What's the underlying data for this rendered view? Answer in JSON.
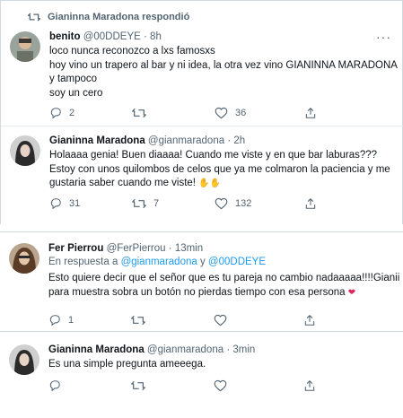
{
  "replied_banner": {
    "text": "Gianinna Maradona respondió"
  },
  "tweets": [
    {
      "name": "benito",
      "handle": "@00DDEYE",
      "time": "8h",
      "lines": [
        "loco nunca reconozco a lxs famosxs",
        "hoy vino un trapero al bar y ni idea, la otra vez vino GIANINNA MARADONA",
        "y tampoco",
        "soy un cero"
      ],
      "stats": {
        "replies": "2",
        "retweets": "",
        "likes": "36"
      }
    },
    {
      "name": "Gianinna Maradona",
      "handle": "@gianmaradona",
      "time": "2h",
      "lines": [
        "Holaaaa genia! Buen diaaaa! Cuando me viste y en que bar laburas???",
        "Estoy con unos quilombos de celos que ya me colmaron la paciencia y me",
        "gustaria saber cuando me viste!"
      ],
      "stats": {
        "replies": "31",
        "retweets": "7",
        "likes": "132"
      }
    },
    {
      "name": "Fer Pierrou",
      "handle": "@FerPierrou",
      "time": "13min",
      "reply_to": {
        "prefix": "En respuesta a",
        "user1": "@gianmaradona",
        "joiner": "y",
        "user2": "@00DDEYE"
      },
      "lines": [
        "Esto quiere decir que el señor que es tu pareja no cambio nadaaaaa!!!!Gianii",
        "para muestra sobra un botón no pierdas tiempo con esa persona"
      ],
      "stats": {
        "replies": "1",
        "retweets": "",
        "likes": ""
      }
    },
    {
      "name": "Gianinna Maradona",
      "handle": "@gianmaradona",
      "time": "3min",
      "lines": [
        "Es una simple pregunta ameeega."
      ],
      "stats": {
        "replies": "",
        "retweets": "",
        "likes": ""
      }
    }
  ],
  "separators": {
    "dot": "·",
    "more": "···"
  },
  "colors": {
    "link": "#1d9bf0",
    "secondary": "#536471",
    "heart": "#e0245e"
  },
  "icons": [
    "retweet-icon",
    "more-icon",
    "reply-icon",
    "like-icon",
    "share-icon",
    "heart-emoji-icon",
    "raised-hands-emoji-icon"
  ]
}
